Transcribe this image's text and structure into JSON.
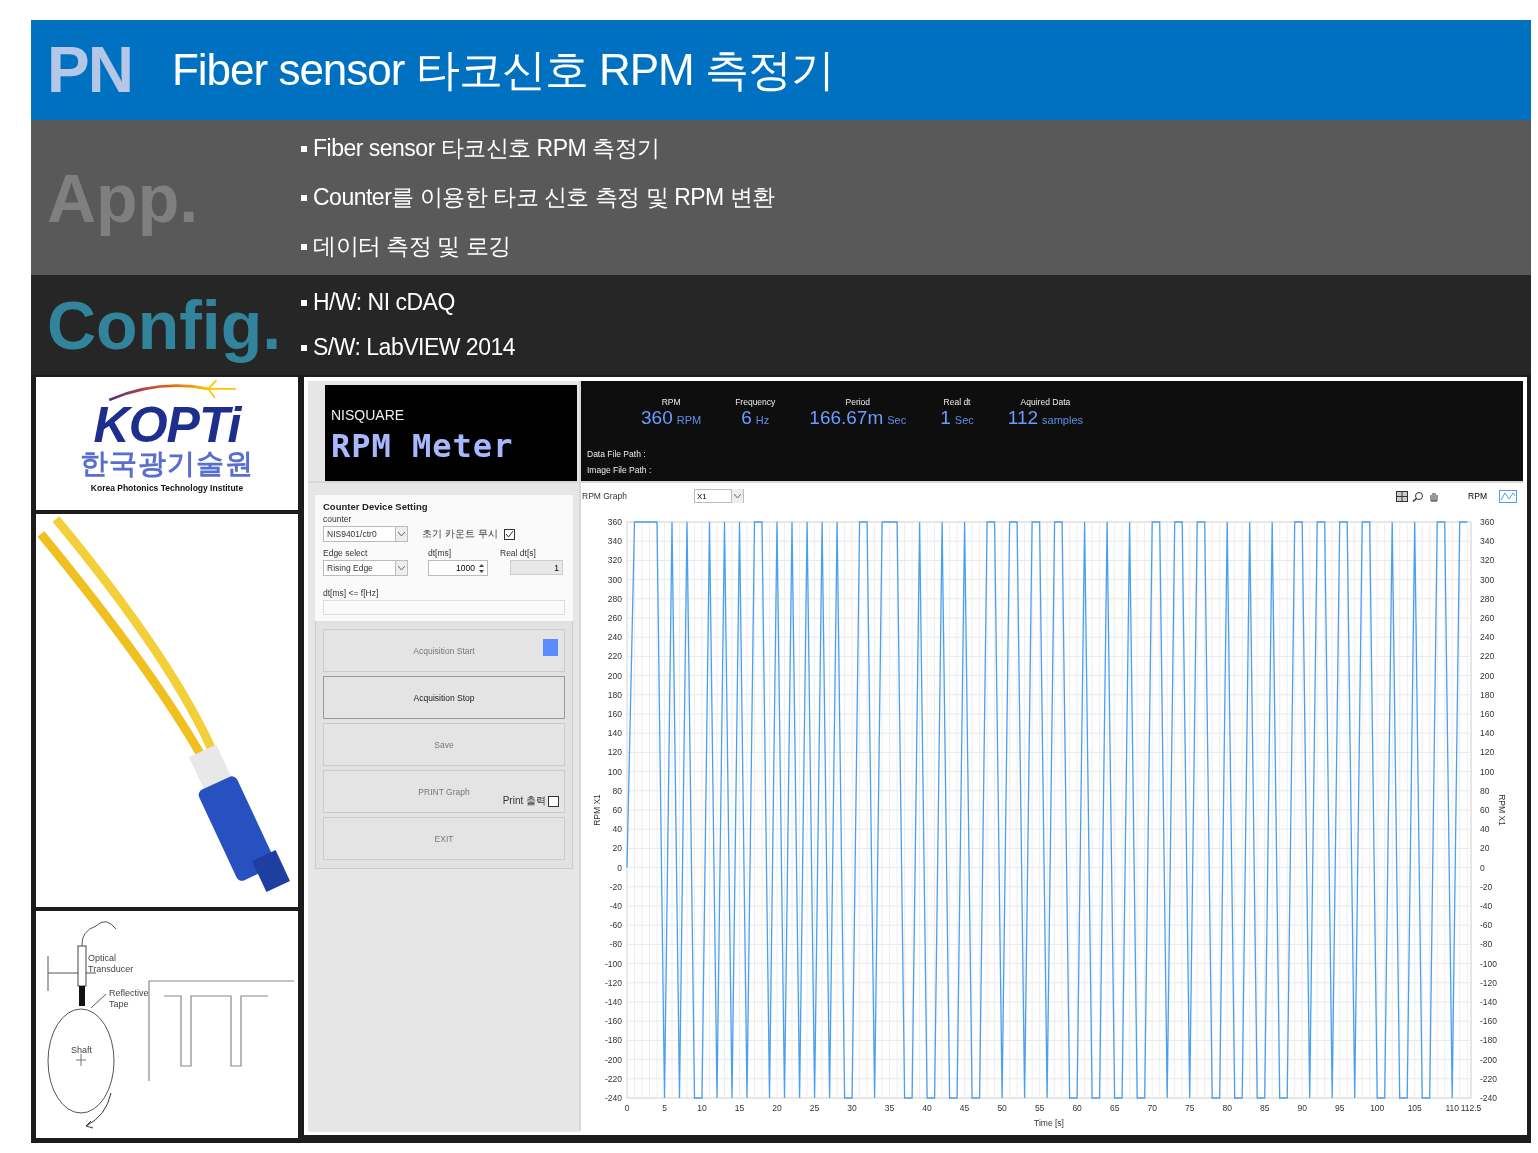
{
  "header": {
    "logo": "PN",
    "title": "Fiber sensor 타코신호 RPM 측정기"
  },
  "sections": [
    {
      "kind": "app",
      "heading": "App.",
      "bullets": [
        "Fiber sensor 타코신호 RPM 측정기",
        "Counter를 이용한 타코 신호 측정 및 RPM 변환",
        "데이터 측정 및 로깅"
      ]
    },
    {
      "kind": "config",
      "heading": "Config.",
      "bullets": [
        "H/W: NI cDAQ",
        "S/W: LabVIEW 2014"
      ]
    }
  ],
  "kopti_logo": {
    "wordmark": "KOPTi",
    "korean": "한국광기술원",
    "english": "Korea Photonics Technology Institute"
  },
  "diagram": {
    "labels": [
      "Optical Transducer",
      "Reflective Tape",
      "Shaft"
    ]
  },
  "app": {
    "brand": "NISQUARE",
    "app_title": "RPM Meter",
    "readouts": [
      {
        "label": "RPM",
        "value": "360",
        "unit": "RPM"
      },
      {
        "label": "Frequency",
        "value": "6",
        "unit": "Hz"
      },
      {
        "label": "Period",
        "value": "166.67m",
        "unit": "Sec"
      },
      {
        "label": "Real dt",
        "value": "1",
        "unit": "Sec"
      },
      {
        "label": "Aquired Data",
        "value": "112",
        "unit": "samples"
      }
    ],
    "paths": [
      "Data File Path  :",
      "Image File Path :"
    ],
    "settings": {
      "title": "Counter Device Setting",
      "counter_label": "counter",
      "counter_value": "NIS9401/ctr0",
      "ignore_initial": {
        "label": "초기 카운트 무시",
        "checked": true
      },
      "edge_label": "Edge select",
      "edge_value": "Rising Edge",
      "dt_label": "dt[ms]",
      "dt_value": "1000",
      "real_dt_label": "Real dt[s]",
      "real_dt_value": "1",
      "rule_label": "dt[ms]  <= f[Hz]"
    },
    "buttons": [
      {
        "label": "Acquisition Start",
        "disabled": true,
        "indicator_on": true
      },
      {
        "label": "Acquisition Stop",
        "disabled": false
      },
      {
        "label": "Save",
        "disabled": true
      },
      {
        "label": "PRINT Graph",
        "disabled": true,
        "print_option": {
          "label": "Print 출력",
          "checked": false
        }
      },
      {
        "label": "EXIT",
        "disabled": true
      }
    ],
    "graph": {
      "title": "RPM Graph",
      "scale": "X1",
      "right_ylabel": "RPM X1",
      "right_yticks": [
        "360",
        "340",
        "320",
        "300",
        "280",
        "260",
        "240",
        "220",
        "200",
        "180",
        "160",
        "140",
        "120",
        "100",
        "80",
        "60",
        "40",
        "20",
        "0",
        "-20",
        "-40",
        "-60",
        "-80",
        "-100",
        "-120",
        "-140",
        "-160",
        "-180",
        "-200",
        "-220",
        "-240"
      ],
      "chart_data": {
        "type": "line",
        "grid": true,
        "xlabel": "Time [s]",
        "ylabel": "RPM X1",
        "xlim": [
          0,
          112.5
        ],
        "ylim": [
          -240,
          360
        ],
        "xticks": [
          0,
          5,
          10,
          15,
          20,
          25,
          30,
          35,
          40,
          45,
          50,
          55,
          60,
          65,
          70,
          75,
          80,
          85,
          90,
          95,
          100,
          105,
          110,
          112.5
        ],
        "yticks": [
          -240,
          -220,
          -200,
          -180,
          -160,
          -140,
          -120,
          -100,
          -80,
          -60,
          -40,
          -20,
          0,
          20,
          40,
          60,
          80,
          100,
          120,
          140,
          160,
          180,
          200,
          220,
          240,
          260,
          280,
          300,
          320,
          340,
          360
        ],
        "x": [
          0,
          1,
          2,
          3,
          4,
          5,
          6,
          7,
          8,
          9,
          10,
          11,
          12,
          13,
          14,
          15,
          16,
          17,
          18,
          19,
          20,
          21,
          22,
          23,
          24,
          25,
          26,
          27,
          28,
          29,
          30,
          31,
          32,
          33,
          34,
          35,
          36,
          37,
          38,
          39,
          40,
          41,
          42,
          43,
          44,
          45,
          46,
          47,
          48,
          49,
          50,
          51,
          52,
          53,
          54,
          55,
          56,
          57,
          58,
          59,
          60,
          61,
          62,
          63,
          64,
          65,
          66,
          67,
          68,
          69,
          70,
          71,
          72,
          73,
          74,
          75,
          76,
          77,
          78,
          79,
          80,
          81,
          82,
          83,
          84,
          85,
          86,
          87,
          88,
          89,
          90,
          91,
          92,
          93,
          94,
          95,
          96,
          97,
          98,
          99,
          100,
          101,
          102,
          103,
          104,
          105,
          106,
          107,
          108,
          109,
          110,
          111,
          112
        ],
        "series": [
          {
            "name": "RPM",
            "color": "#4a9ff0",
            "values": [
              0,
              360,
              360,
              360,
              360,
              -240,
              360,
              -240,
              360,
              -240,
              -240,
              360,
              -240,
              360,
              -240,
              360,
              -240,
              360,
              360,
              -240,
              360,
              -240,
              360,
              -240,
              360,
              -240,
              360,
              -240,
              360,
              -240,
              -240,
              360,
              360,
              -240,
              360,
              360,
              360,
              -240,
              -240,
              360,
              -240,
              -240,
              360,
              -240,
              -240,
              360,
              -240,
              -240,
              360,
              360,
              -240,
              360,
              360,
              -240,
              360,
              360,
              -240,
              360,
              360,
              -240,
              -240,
              360,
              -240,
              -240,
              360,
              -240,
              -240,
              360,
              -240,
              -240,
              360,
              360,
              -240,
              360,
              360,
              -240,
              360,
              360,
              -240,
              -240,
              360,
              -240,
              -240,
              360,
              -240,
              -240,
              360,
              -240,
              -240,
              360,
              360,
              -240,
              360,
              360,
              -240,
              360,
              360,
              -240,
              360,
              360,
              -240,
              -240,
              360,
              -240,
              -240,
              360,
              -240,
              -240,
              360,
              360,
              -240,
              360,
              360
            ]
          }
        ]
      }
    }
  }
}
